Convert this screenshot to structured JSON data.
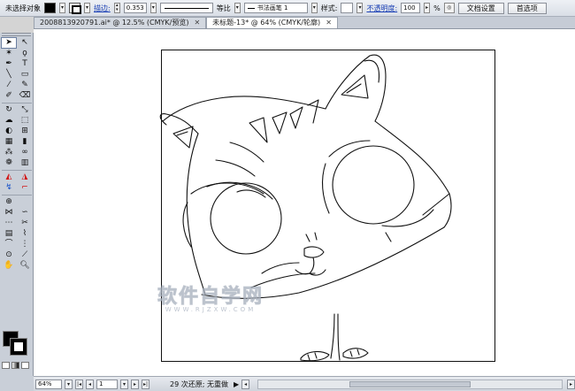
{
  "control_bar": {
    "selection_label": "未选择对象",
    "stroke_label": "描边:",
    "stroke_weight": "0.353",
    "profile_label": "等比",
    "brush_label": "书法画笔 1",
    "style_label": "样式:",
    "opacity_label": "不透明度:",
    "opacity_value": "100",
    "opacity_unit": "%",
    "doc_setup_button": "文档设置",
    "preferences_button": "首选项"
  },
  "tabs": [
    {
      "label": "2008813920791.ai* @ 12.5% (CMYK/预览)",
      "active": false
    },
    {
      "label": "未标题-13* @ 64% (CMYK/轮廓)",
      "active": true
    }
  ],
  "canvas": {
    "watermark_main": "软件自学网",
    "watermark_url": "WWW.RJZXW.COM"
  },
  "status_bar": {
    "zoom": "64%",
    "artboard_number": "1",
    "message": "29 次还原; 无重做",
    "arrow": "▶"
  },
  "colors": {
    "fill": "#000000",
    "stroke": "#000000",
    "link_blue": "#1a3fb5",
    "chrome": "#c9cfd8"
  },
  "icons": {
    "selection": "selection-arrow-icon",
    "direct_selection": "direct-selection-icon",
    "type": "type-tool-icon",
    "zoom": "zoom-tool-icon",
    "hand": "hand-tool-icon"
  }
}
